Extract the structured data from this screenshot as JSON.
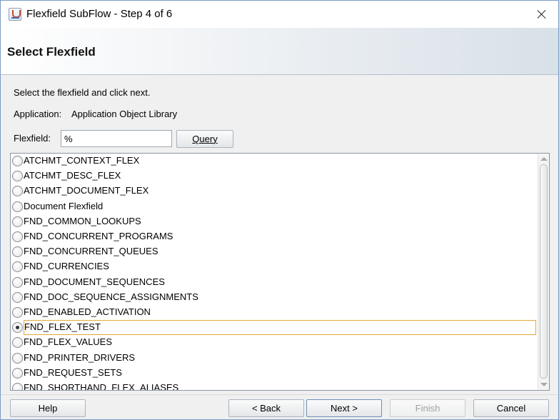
{
  "window": {
    "title": "Flexfield SubFlow - Step 4 of 6",
    "icon": "java-app-icon",
    "close_icon": "close-icon"
  },
  "header": {
    "title": "Select Flexfield"
  },
  "body": {
    "instruction": "Select the flexfield and click next.",
    "application_label": "Application:",
    "application_value": "Application Object Library",
    "flexfield_label": "Flexfield:",
    "flexfield_value": "%",
    "query_label": "Query"
  },
  "list": {
    "selected_index": 11,
    "items": [
      "ATCHMT_CONTEXT_FLEX",
      "ATCHMT_DESC_FLEX",
      "ATCHMT_DOCUMENT_FLEX",
      "Document Flexfield",
      "FND_COMMON_LOOKUPS",
      "FND_CONCURRENT_PROGRAMS",
      "FND_CONCURRENT_QUEUES",
      "FND_CURRENCIES",
      "FND_DOCUMENT_SEQUENCES",
      "FND_DOC_SEQUENCE_ASSIGNMENTS",
      "FND_ENABLED_ACTIVATION",
      "FND_FLEX_TEST",
      "FND_FLEX_VALUES",
      "FND_PRINTER_DRIVERS",
      "FND_REQUEST_SETS",
      "FND_SHORTHAND_FLEX_ALIASES"
    ]
  },
  "footer": {
    "help": "Help",
    "back": "< Back",
    "next": "Next >",
    "finish": "Finish",
    "cancel": "Cancel",
    "finish_enabled": false
  }
}
